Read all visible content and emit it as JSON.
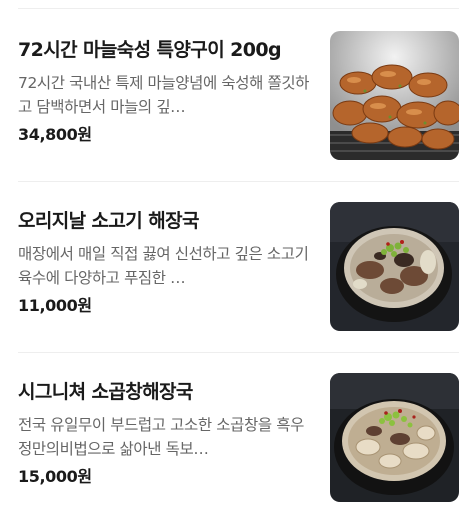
{
  "items": [
    {
      "title": "72시간 마늘숙성 특양구이 200g",
      "description": "72시간 국내산 특제 마늘양념에 숙성해 쫄깃하고 담백하면서 마늘의 깊…",
      "price": "34,800원",
      "image_icon": "grilled-tripe-photo"
    },
    {
      "title": "오리지날 소고기 해장국",
      "description": "매장에서 매일 직접 끓여 신선하고 깊은 소고기 육수에 다양하고 푸짐한 …",
      "price": "11,000원",
      "image_icon": "beef-hangover-soup-photo"
    },
    {
      "title": "시그니쳐 소곱창해장국",
      "description": "전국 유일무이 부드럽고 고소한 소곱창을 흑우정만의비법으로 삶아낸 독보…",
      "price": "15,000원",
      "image_icon": "beef-intestine-soup-photo"
    }
  ]
}
